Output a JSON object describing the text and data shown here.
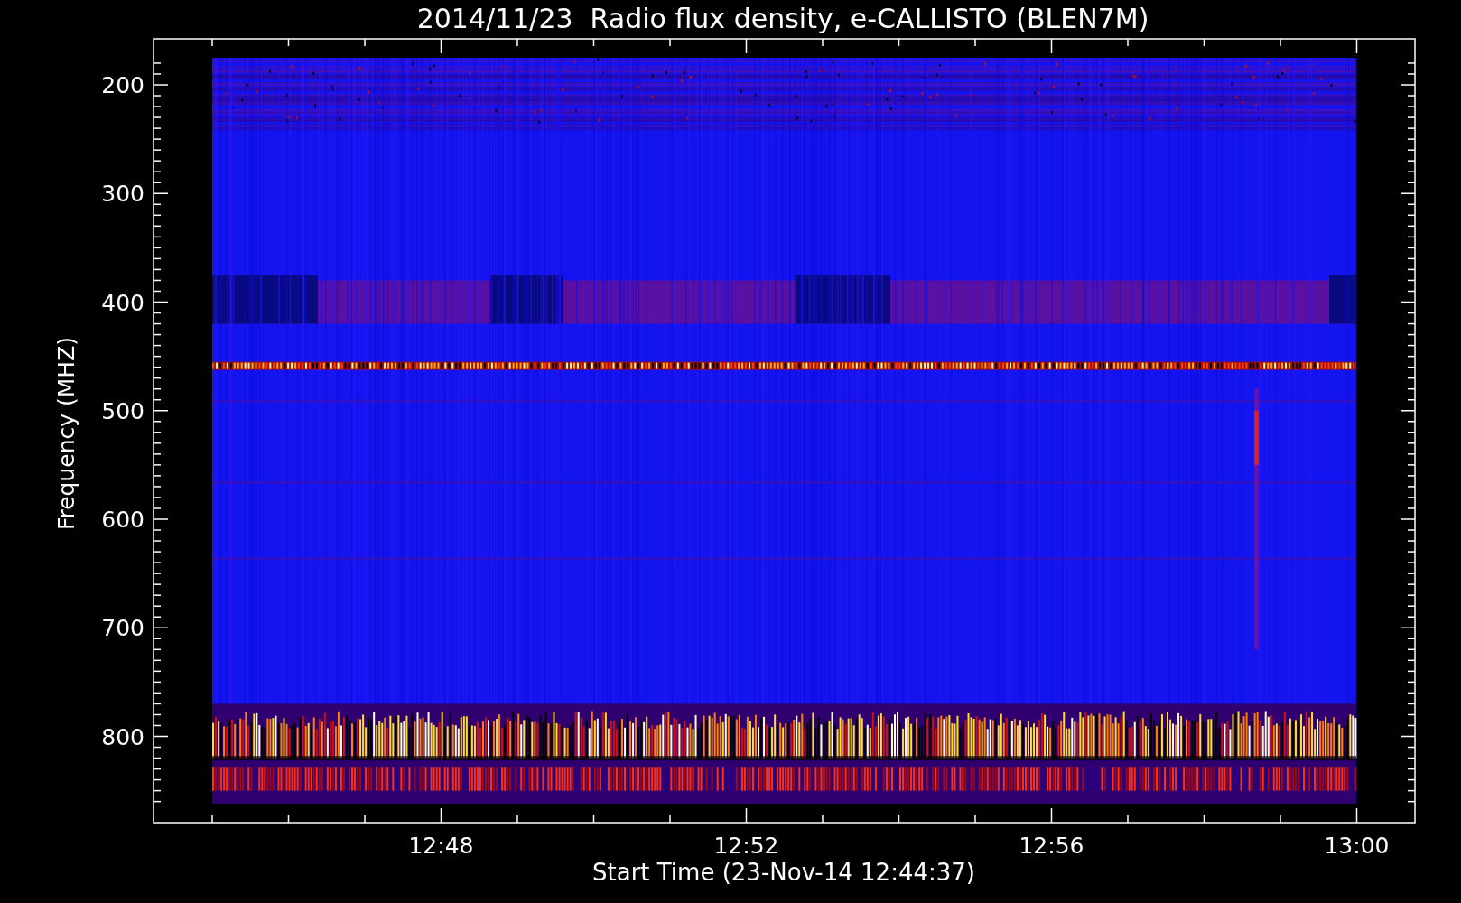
{
  "title": "2014/11/23  Radio flux density, e-CALLISTO (BLEN7M)",
  "y_axis": {
    "label": "Frequency (MHZ)",
    "ticks": [
      "200",
      "300",
      "400",
      "500",
      "600",
      "700",
      "800"
    ]
  },
  "x_axis": {
    "label": "Start Time (23-Nov-14 12:44:37)",
    "ticks": [
      "12:48",
      "12:52",
      "12:56",
      "13:00"
    ]
  }
}
